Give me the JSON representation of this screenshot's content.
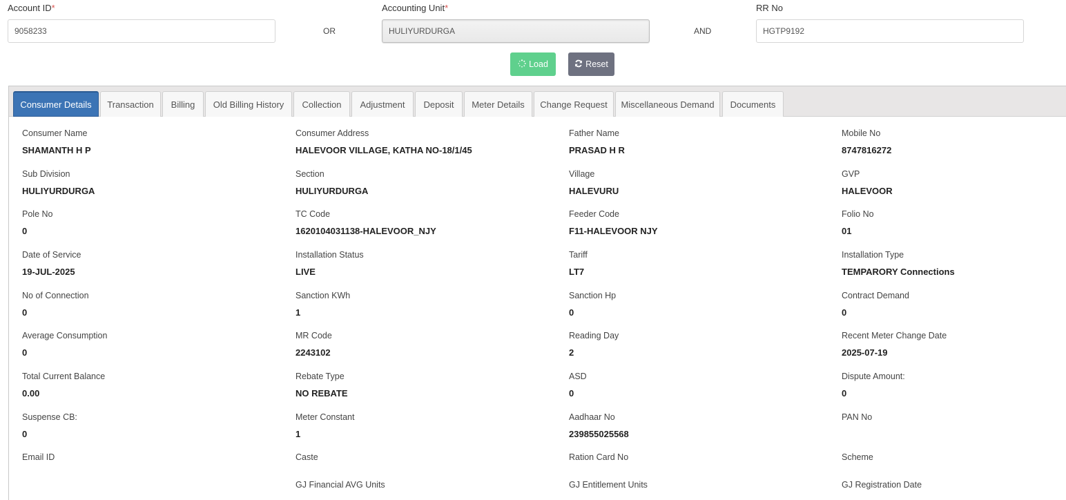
{
  "search": {
    "account_id": {
      "label": "Account ID",
      "required_mark": "*",
      "value": "9058233"
    },
    "or_text": "OR",
    "accounting_unit": {
      "label": "Accounting Unit",
      "required_mark": "*",
      "value": "HULIYURDURGA"
    },
    "and_text": "AND",
    "rr_no": {
      "label": "RR No",
      "value": "HGTP9192"
    },
    "load_label": "Load",
    "reset_label": "Reset"
  },
  "tabs": [
    {
      "label": "Consumer Details",
      "active": true
    },
    {
      "label": "Transaction"
    },
    {
      "label": "Billing"
    },
    {
      "label": "Old Billing History"
    },
    {
      "label": "Collection"
    },
    {
      "label": "Adjustment"
    },
    {
      "label": "Deposit"
    },
    {
      "label": "Meter Details"
    },
    {
      "label": "Change Request"
    },
    {
      "label": "Miscellaneous Demand"
    },
    {
      "label": "Documents"
    }
  ],
  "consumer": {
    "consumer_name": {
      "label": "Consumer Name",
      "value": "SHAMANTH H P"
    },
    "consumer_address": {
      "label": "Consumer Address",
      "value": "HALEVOOR VILLAGE, KATHA NO-18/1/45"
    },
    "father_name": {
      "label": "Father Name",
      "value": "PRASAD H R"
    },
    "mobile_no": {
      "label": "Mobile No",
      "value": "8747816272"
    },
    "sub_division": {
      "label": "Sub Division",
      "value": "HULIYURDURGA"
    },
    "section": {
      "label": "Section",
      "value": "HULIYURDURGA"
    },
    "village": {
      "label": "Village",
      "value": "HALEVURU"
    },
    "gvp": {
      "label": "GVP",
      "value": "HALEVOOR"
    },
    "pole_no": {
      "label": "Pole No",
      "value": "0"
    },
    "tc_code": {
      "label": "TC Code",
      "value": "1620104031138-HALEVOOR_NJY"
    },
    "feeder_code": {
      "label": "Feeder Code",
      "value": "F11-HALEVOOR NJY"
    },
    "folio_no": {
      "label": "Folio No",
      "value": "01"
    },
    "date_of_service": {
      "label": "Date of Service",
      "value": "19-JUL-2025"
    },
    "installation_status": {
      "label": "Installation Status",
      "value": "LIVE"
    },
    "tariff": {
      "label": "Tariff",
      "value": "LT7"
    },
    "installation_type": {
      "label": "Installation Type",
      "value": "TEMPARORY Connections"
    },
    "no_of_connection": {
      "label": "No of Connection",
      "value": "0"
    },
    "sanction_kwh": {
      "label": "Sanction KWh",
      "value": "1"
    },
    "sanction_hp": {
      "label": "Sanction Hp",
      "value": "0"
    },
    "contract_demand": {
      "label": "Contract Demand",
      "value": "0"
    },
    "average_consumption": {
      "label": "Average Consumption",
      "value": "0"
    },
    "mr_code": {
      "label": "MR Code",
      "value": "2243102"
    },
    "reading_day": {
      "label": "Reading Day",
      "value": "2"
    },
    "recent_meter_change": {
      "label": "Recent Meter Change Date",
      "value": "2025-07-19"
    },
    "total_current_balance": {
      "label": "Total Current Balance",
      "value": "0.00"
    },
    "rebate_type": {
      "label": "Rebate Type",
      "value": "NO REBATE"
    },
    "asd": {
      "label": "ASD",
      "value": "0"
    },
    "dispute_amount": {
      "label": "Dispute Amount:",
      "value": "0"
    },
    "suspense_cb": {
      "label": "Suspense CB:",
      "value": "0"
    },
    "meter_constant": {
      "label": "Meter Constant",
      "value": "1"
    },
    "aadhaar_no": {
      "label": "Aadhaar No",
      "value": "239855025568"
    },
    "pan_no": {
      "label": "PAN No",
      "value": ""
    },
    "email_id": {
      "label": "Email ID",
      "value": ""
    },
    "caste": {
      "label": "Caste",
      "value": ""
    },
    "ration_card_no": {
      "label": "Ration Card No",
      "value": ""
    },
    "scheme": {
      "label": "Scheme",
      "value": ""
    },
    "gj_financial_avg": {
      "label": "GJ Financial AVG Units",
      "value": ""
    },
    "gj_entitlement": {
      "label": "GJ Entitlement Units",
      "value": ""
    },
    "gj_registration_date": {
      "label": "GJ Registration Date",
      "value": ""
    }
  }
}
